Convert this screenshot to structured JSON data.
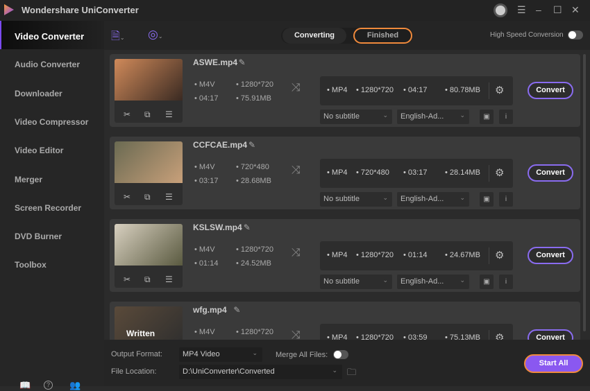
{
  "app": {
    "title": "Wondershare UniConverter"
  },
  "sidebar": {
    "items": [
      {
        "label": "Video Converter",
        "active": true
      },
      {
        "label": "Audio Converter"
      },
      {
        "label": "Downloader"
      },
      {
        "label": "Video Compressor"
      },
      {
        "label": "Video Editor"
      },
      {
        "label": "Merger"
      },
      {
        "label": "Screen Recorder"
      },
      {
        "label": "DVD Burner"
      },
      {
        "label": "Toolbox"
      }
    ]
  },
  "toolbar": {
    "tabs": [
      "Converting",
      "Finished"
    ],
    "active_tab": "Finished",
    "high_speed_label": "High Speed Conversion",
    "high_speed_on": false
  },
  "files": [
    {
      "name": "ASWE.mp4",
      "src_format": "M4V",
      "src_res": "1280*720",
      "src_duration": "04:17",
      "src_size": "75.91MB",
      "out_format": "MP4",
      "out_res": "1280*720",
      "out_duration": "04:17",
      "out_size": "80.78MB",
      "subtitle": "No subtitle",
      "audio": "English-Ad...",
      "convert_label": "Convert",
      "thumb_colors": [
        "#d08a5a",
        "#3a2a22"
      ]
    },
    {
      "name": "CCFCAE.mp4",
      "src_format": "M4V",
      "src_res": "720*480",
      "src_duration": "03:17",
      "src_size": "28.68MB",
      "out_format": "MP4",
      "out_res": "720*480",
      "out_duration": "03:17",
      "out_size": "28.14MB",
      "subtitle": "No subtitle",
      "audio": "English-Ad...",
      "convert_label": "Convert",
      "thumb_colors": [
        "#6a6a52",
        "#c8a07a"
      ]
    },
    {
      "name": "KSLSW.mp4",
      "src_format": "M4V",
      "src_res": "1280*720",
      "src_duration": "01:14",
      "src_size": "24.52MB",
      "out_format": "MP4",
      "out_res": "1280*720",
      "out_duration": "01:14",
      "out_size": "24.67MB",
      "subtitle": "No subtitle",
      "audio": "English-Ad...",
      "convert_label": "Convert",
      "thumb_colors": [
        "#d8d0c0",
        "#5a5a40"
      ]
    },
    {
      "name": "wfg.mp4",
      "src_format": "M4V",
      "src_res": "1280*720",
      "src_duration": "",
      "src_size": "",
      "out_format": "MP4",
      "out_res": "1280*720",
      "out_duration": "03:59",
      "out_size": "75.13MB",
      "subtitle": "",
      "audio": "",
      "convert_label": "Convert",
      "thumb_colors": [
        "#5a4a3a",
        "#2e2e2e"
      ],
      "thumb_text": "Written"
    }
  ],
  "bottom": {
    "output_format_label": "Output Format:",
    "output_format": "MP4 Video",
    "merge_label": "Merge All Files:",
    "merge_on": false,
    "file_location_label": "File Location:",
    "file_location": "D:\\UniConverter\\Converted",
    "start_all_label": "Start All"
  },
  "colors": {
    "accent": "#8a58f0",
    "highlight": "#f08a3c"
  }
}
